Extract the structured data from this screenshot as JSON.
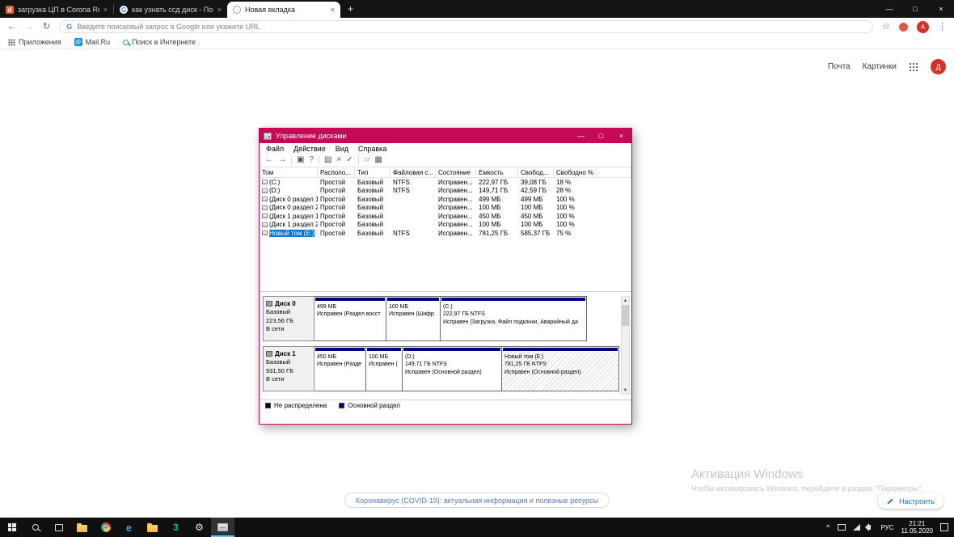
{
  "colors": {
    "accent": "#c40a54",
    "navy": "#000080",
    "selection": "#0078d7",
    "avatar": "#d93025"
  },
  "icons": {
    "back": "←",
    "forward": "→",
    "reload": "↻",
    "star": "☆",
    "menu": "⋮",
    "minimize": "—",
    "maximize": "□",
    "close": "×",
    "new_tab": "+",
    "scroll_up": "▲",
    "scroll_down": "▼",
    "tray_caret": "^"
  },
  "browser": {
    "tabs": [
      {
        "title": "загрузка ЦП в Corona Render",
        "favicon_letter": "d",
        "active": false
      },
      {
        "title": "как узнать ссд диск - Поиск в G",
        "favicon_letter": "G",
        "active": false
      },
      {
        "title": "Новая вкладка",
        "favicon_letter": "",
        "active": true
      }
    ],
    "omnibox_placeholder": "Введите поисковый запрос в Google или укажите URL",
    "search_engine_letter": "G",
    "profile_initial": "А",
    "bookmarks": [
      {
        "label": "Приложения"
      },
      {
        "label": "Mail.Ru",
        "icon_letter": "@"
      },
      {
        "label": "Поиск в Интернете"
      }
    ]
  },
  "page": {
    "nav_links": [
      "Почта",
      "Картинки"
    ],
    "profile_initial": "Д",
    "covid_chip": "Коронавирус (COVID-19): актуальная информация и полезные ресурсы",
    "customize_button": "Настроить",
    "watermark": {
      "line1": "Активация Windows",
      "line2": "Чтобы активировать Windows, перейдите в раздел \"Параметры\"."
    }
  },
  "disk_management": {
    "window_title": "Управление дисками",
    "menu": [
      "Файл",
      "Действие",
      "Вид",
      "Справка"
    ],
    "toolbar": [
      {
        "icon": "back",
        "glyph": "←"
      },
      {
        "icon": "forward",
        "glyph": "→"
      },
      {
        "icon": "console-tree",
        "glyph": "▣"
      },
      {
        "icon": "help",
        "glyph": "?"
      },
      {
        "icon": "up-level",
        "glyph": "▤"
      },
      {
        "icon": "delete",
        "glyph": "×"
      },
      {
        "icon": "check",
        "glyph": "✓"
      },
      {
        "icon": "folder",
        "glyph": "▱"
      },
      {
        "icon": "columns",
        "glyph": "▦"
      }
    ],
    "columns": [
      "Том",
      "Располо...",
      "Тип",
      "Файловая с...",
      "Состояние",
      "Емкость",
      "Свобод...",
      "Свободно %"
    ],
    "volumes": [
      {
        "name": "(C:)",
        "layout": "Простой",
        "type": "Базовый",
        "fs": "NTFS",
        "status": "Исправен...",
        "capacity": "222,97 ГБ",
        "free": "39,08 ГБ",
        "pct": "18 %",
        "selected": false
      },
      {
        "name": "(D:)",
        "layout": "Простой",
        "type": "Базовый",
        "fs": "NTFS",
        "status": "Исправен...",
        "capacity": "149,71 ГБ",
        "free": "42,59 ГБ",
        "pct": "28 %",
        "selected": false
      },
      {
        "name": "(Диск 0 раздел 1)",
        "layout": "Простой",
        "type": "Базовый",
        "fs": "",
        "status": "Исправен...",
        "capacity": "499 МБ",
        "free": "499 МБ",
        "pct": "100 %",
        "selected": false
      },
      {
        "name": "(Диск 0 раздел 2)",
        "layout": "Простой",
        "type": "Базовый",
        "fs": "",
        "status": "Исправен...",
        "capacity": "100 МБ",
        "free": "100 МБ",
        "pct": "100 %",
        "selected": false
      },
      {
        "name": "(Диск 1 раздел 1)",
        "layout": "Простой",
        "type": "Базовый",
        "fs": "",
        "status": "Исправен...",
        "capacity": "450 МБ",
        "free": "450 МБ",
        "pct": "100 %",
        "selected": false
      },
      {
        "name": "(Диск 1 раздел 2)",
        "layout": "Простой",
        "type": "Базовый",
        "fs": "",
        "status": "Исправен...",
        "capacity": "100 МБ",
        "free": "100 МБ",
        "pct": "100 %",
        "selected": false
      },
      {
        "name": "Новый том (E:)",
        "layout": "Простой",
        "type": "Базовый",
        "fs": "NTFS",
        "status": "Исправен...",
        "capacity": "781,25 ГБ",
        "free": "585,37 ГБ",
        "pct": "75 %",
        "selected": true
      }
    ],
    "disks": [
      {
        "name": "Диск 0",
        "type": "Базовый",
        "size": "223,56 ГБ",
        "status": "В сети",
        "partitions": [
          {
            "name": "",
            "size_line": "499 МБ",
            "status_line": "Исправен (Раздел восст"
          },
          {
            "name": "",
            "size_line": "100 МБ",
            "status_line": "Исправен (Шифр"
          },
          {
            "name": "(C:)",
            "size_line": "222,97 ГБ NTFS",
            "status_line": "Исправен (Загрузка, Файл подкачки, Аварийный да"
          }
        ]
      },
      {
        "name": "Диск 1",
        "type": "Базовый",
        "size": "931,50 ГБ",
        "status": "В сети",
        "partitions": [
          {
            "name": "",
            "size_line": "450 МБ",
            "status_line": "Исправен (Разде"
          },
          {
            "name": "",
            "size_line": "100 МБ",
            "status_line": "Исправен ("
          },
          {
            "name": "(D:)",
            "size_line": "149,71 ГБ NTFS",
            "status_line": "Исправен (Основной раздел)"
          },
          {
            "name": "Новый том (E:)",
            "size_line": "781,25 ГБ NTFS",
            "status_line": "Исправен (Основной раздел)",
            "selected": true
          }
        ]
      }
    ],
    "legend": [
      {
        "label": "Не распределена",
        "color": "#000000"
      },
      {
        "label": "Основной раздел",
        "color": "#000080"
      }
    ]
  },
  "taskbar": {
    "language": "РУС",
    "time": "21:21",
    "date": "11.05.2020",
    "apps": [
      {
        "name": "file-explorer"
      },
      {
        "name": "chrome"
      },
      {
        "name": "edge",
        "glyph": "e"
      },
      {
        "name": "folder"
      },
      {
        "name": "3ds-max",
        "glyph": "3"
      },
      {
        "name": "settings",
        "glyph": "⚙"
      },
      {
        "name": "disk-management",
        "active": true
      }
    ]
  }
}
